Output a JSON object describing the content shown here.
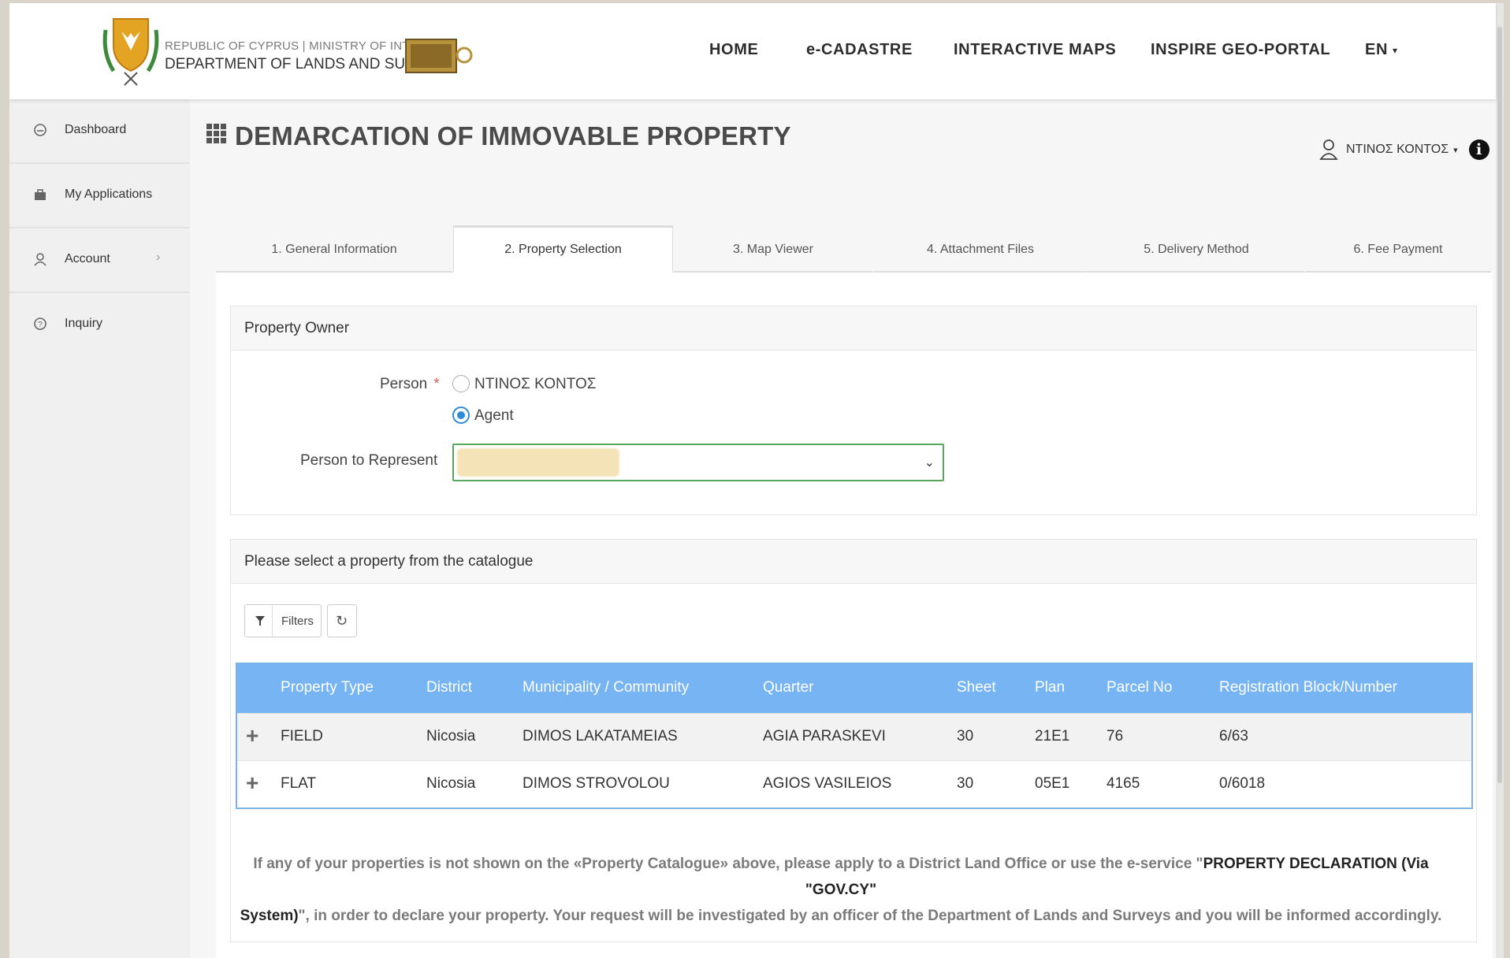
{
  "header": {
    "brand_line1": "REPUBLIC OF CYPRUS | MINISTRY OF INTERIOR",
    "brand_line2": "DEPARTMENT OF LANDS AND SURVEYS",
    "nav": [
      {
        "label": "HOME"
      },
      {
        "label": "e-CADASTRE"
      },
      {
        "label": "INTERACTIVE MAPS"
      },
      {
        "label": "INSPIRE GEO-PORTAL"
      },
      {
        "label": "EN"
      }
    ]
  },
  "sidebar": {
    "items": [
      {
        "label": "Dashboard",
        "icon": "dashboard-icon"
      },
      {
        "label": "My Applications",
        "icon": "briefcase-icon"
      },
      {
        "label": "Account",
        "icon": "user-icon"
      },
      {
        "label": "Inquiry",
        "icon": "question-icon"
      }
    ]
  },
  "page": {
    "title": "DEMARCATION OF IMMOVABLE PROPERTY",
    "user_name": "ΝΤΙΝΟΣ ΚΟΝΤΟΣ"
  },
  "tabs": [
    {
      "label": "1. General Information"
    },
    {
      "label": "2. Property Selection",
      "active": true
    },
    {
      "label": "3. Map Viewer"
    },
    {
      "label": "4. Attachment Files"
    },
    {
      "label": "5. Delivery Method"
    },
    {
      "label": "6. Fee Payment"
    }
  ],
  "owner": {
    "heading": "Property Owner",
    "person_label": "Person",
    "required_mark": "*",
    "options": [
      {
        "label": "ΝΤΙΝΟΣ ΚΟΝΤΟΣ",
        "checked": false
      },
      {
        "label": "Agent",
        "checked": true
      }
    ],
    "represent_label": "Person to Represent"
  },
  "catalogue": {
    "heading": "Please select a property from the catalogue",
    "filters_label": "Filters",
    "columns": [
      "Property Type",
      "District",
      "Municipality / Community",
      "Quarter",
      "Sheet",
      "Plan",
      "Parcel No",
      "Registration Block/Number"
    ],
    "rows": [
      [
        "FIELD",
        "Nicosia",
        "DIMOS LAKATAMEIAS",
        "AGIA PARASKEVI",
        "30",
        "21E1",
        "76",
        "6/63"
      ],
      [
        "FLAT",
        "Nicosia",
        "DIMOS STROVOLOU",
        "AGIOS VASILEIOS",
        "30",
        "05E1",
        "4165",
        "0/6018"
      ]
    ],
    "notice_part1": "If any of your properties is not shown on the «Property Catalogue» above, please apply to a District Land Office or use the e-service \"",
    "notice_bold1": "PROPERTY DECLARATION (Via \"GOV.CY\"",
    "notice_bold2": "System)",
    "notice_part2": "\", in order to declare your property. Your request will be investigated by an officer of the Department of Lands and Surveys and you will be informed accordingly."
  },
  "colors": {
    "table_header": "#76b4f4",
    "radio_accent": "#2f8ad8",
    "select_border": "#58a65c"
  }
}
